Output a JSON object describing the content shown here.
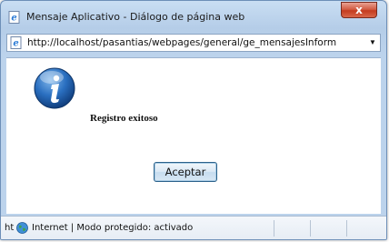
{
  "window": {
    "title": "Mensaje Aplicativo - Diálogo de página web",
    "close_label": "x"
  },
  "address_bar": {
    "url": "http://localhost/pasantias/webpages/general/ge_mensajesInform",
    "dropdown_icon": "chevron-down-icon"
  },
  "dialog": {
    "icon": "info-icon",
    "message": "Registro exitoso",
    "accept_label": "Aceptar"
  },
  "status_bar": {
    "prefix": "ht",
    "zone_icon": "globe-icon",
    "zone_text": "Internet | Modo protegido: activado"
  },
  "colors": {
    "title_bar": "#bcd3ec",
    "close_button": "#c43c1f",
    "info_icon": "#1f5fa8",
    "accept_border": "#2c628b"
  }
}
